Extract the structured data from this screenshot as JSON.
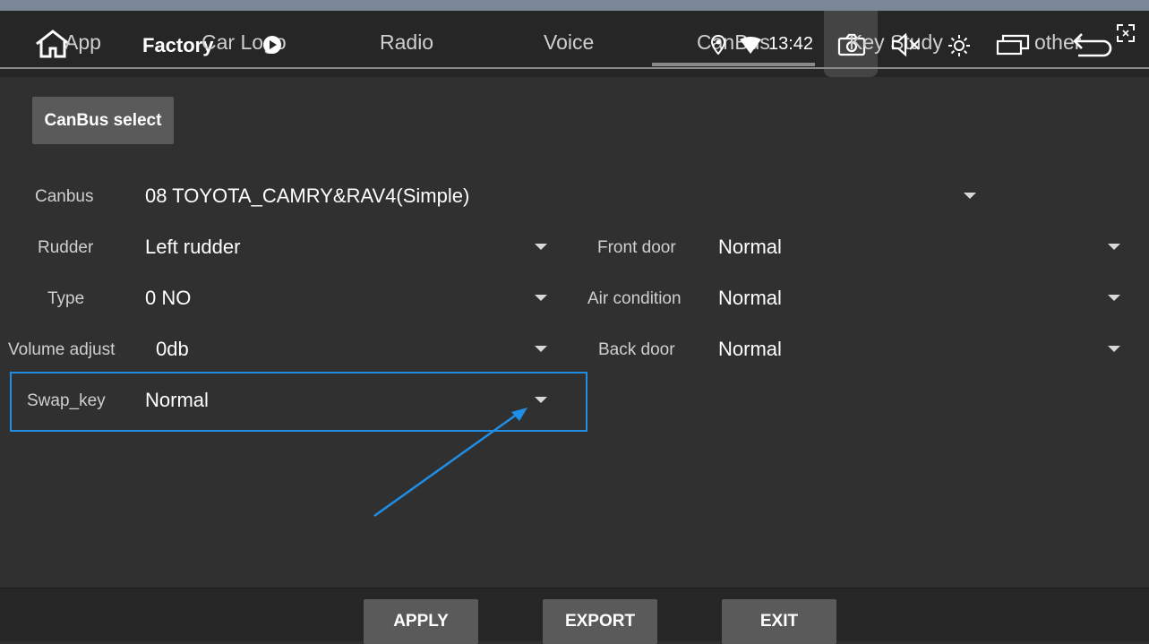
{
  "tabs": [
    {
      "label": "App",
      "active": false
    },
    {
      "label": "Factory",
      "active": true
    },
    {
      "label": "Car Logo",
      "active": false
    },
    {
      "label": "Radio",
      "active": false
    },
    {
      "label": "Voice",
      "active": false
    },
    {
      "label": "CanBus",
      "active": false
    },
    {
      "label": "Key Study",
      "active": false
    },
    {
      "label": "other",
      "active": false
    }
  ],
  "status": {
    "time": "13:42",
    "icons": [
      "home-icon",
      "play-icon",
      "location-icon",
      "wifi-icon",
      "camera-icon",
      "mute-icon",
      "brightness-icon",
      "window-icon",
      "back-icon",
      "fullscreen-icon"
    ]
  },
  "canbus_select_label": "CanBus select",
  "settings": {
    "canbus": {
      "label": "Canbus",
      "value": "08 TOYOTA_CAMRY&RAV4(Simple)"
    },
    "rudder": {
      "label": "Rudder",
      "value": "Left rudder"
    },
    "type": {
      "label": "Type",
      "value": "0 NO"
    },
    "volume_adjust": {
      "label": "Volume adjust",
      "value": "0db"
    },
    "swap_key": {
      "label": "Swap_key",
      "value": "Normal"
    },
    "front_door": {
      "label": "Front door",
      "value": "Normal"
    },
    "air_condition": {
      "label": "Air condition",
      "value": "Normal"
    },
    "back_door": {
      "label": "Back door",
      "value": "Normal"
    }
  },
  "buttons": {
    "apply": "APPLY",
    "export": "EXPORT",
    "exit": "EXIT"
  },
  "colors": {
    "highlight": "#1e8ee6",
    "background": "#303030",
    "button": "#5a5a5a"
  }
}
